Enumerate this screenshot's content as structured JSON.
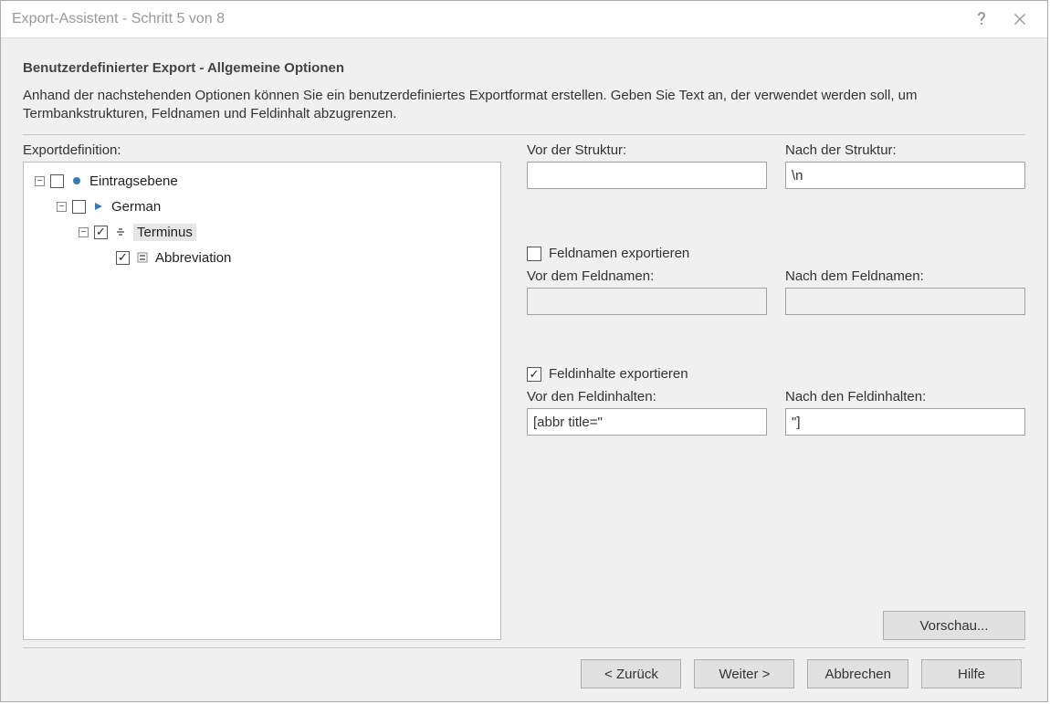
{
  "window": {
    "title": "Export-Assistent - Schritt 5 von 8"
  },
  "header": {
    "section_title": "Benutzerdefinierter Export - Allgemeine Optionen",
    "description": "Anhand der nachstehenden Optionen können Sie ein benutzerdefiniertes Exportformat erstellen. Geben Sie Text an, der verwendet werden soll, um Termbankstrukturen, Feldnamen und Feldinhalt abzugrenzen."
  },
  "left": {
    "label": "Exportdefinition:",
    "tree": [
      {
        "level": 0,
        "expanded": true,
        "checked": false,
        "icon": "entry-level-icon",
        "label": "Eintragsebene"
      },
      {
        "level": 1,
        "expanded": true,
        "checked": false,
        "icon": "language-icon",
        "label": "German"
      },
      {
        "level": 2,
        "expanded": true,
        "checked": true,
        "icon": "term-icon",
        "label": "Terminus",
        "selected": true
      },
      {
        "level": 3,
        "expanded": null,
        "checked": true,
        "icon": "field-icon",
        "label": "Abbreviation"
      }
    ]
  },
  "right": {
    "structure": {
      "before_label": "Vor der Struktur:",
      "before_value": "",
      "after_label": "Nach der Struktur:",
      "after_value": "\\n"
    },
    "fieldnames": {
      "export_checked": false,
      "export_label": "Feldnamen exportieren",
      "before_label": "Vor dem Feldnamen:",
      "before_value": "",
      "after_label": "Nach dem Feldnamen:",
      "after_value": ""
    },
    "fieldcontents": {
      "export_checked": true,
      "export_label": "Feldinhalte exportieren",
      "before_label": "Vor den Feldinhalten:",
      "before_value": "[abbr title=\"",
      "after_label": "Nach den Feldinhalten:",
      "after_value": "\"]"
    },
    "preview_label": "Vorschau..."
  },
  "footer": {
    "back": "< Zurück",
    "next": "Weiter >",
    "cancel": "Abbrechen",
    "help": "Hilfe"
  }
}
